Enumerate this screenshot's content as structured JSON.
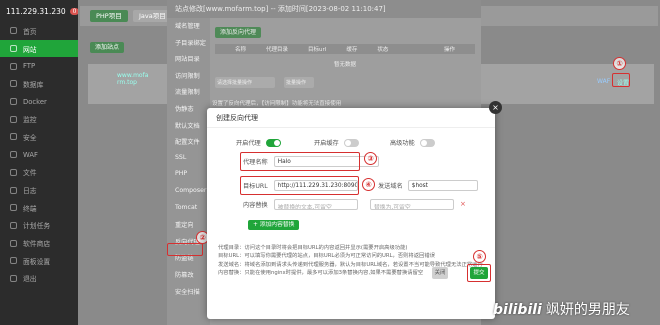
{
  "sidebar": {
    "server_ip": "111.229.31.230",
    "badge": "0",
    "items": [
      "首页",
      "网站",
      "FTP",
      "数据库",
      "Docker",
      "监控",
      "安全",
      "WAF",
      "文件",
      "日志",
      "终端",
      "计划任务",
      "软件商店",
      "面板设置",
      "退出"
    ],
    "active_index": 1
  },
  "background": {
    "tabs": [
      "PHP项目",
      "Java项目"
    ],
    "add_site": "添加站点",
    "site_name": "www.mofa\nrm.top",
    "setting_link": "设置",
    "waf_link": "WAF"
  },
  "site_dialog": {
    "title": "站点修改[www.mofarm.top] -- 添加时间[2023-08-02 11:10:47]",
    "nav": [
      "域名管理",
      "子目录绑定",
      "网站目录",
      "访问限制",
      "流量限制",
      "伪静态",
      "默认文档",
      "配置文件",
      "SSL",
      "PHP",
      "Composer",
      "Tomcat",
      "重定向",
      "反向代理",
      "防盗链",
      "防篡改",
      "安全扫描"
    ],
    "add_proxy_button": "添加反向代理",
    "columns": [
      "名称",
      "代理目录",
      "目标url",
      "缓存",
      "状态",
      "操作"
    ],
    "empty_text": "暂无数据",
    "bulk_select": "请选择批量操作",
    "bulk_exec": "批量操作",
    "tip": "设置了反向代理后，【访问限制】功能将无法直接使用"
  },
  "proxy_dialog": {
    "title": "创建反向代理",
    "enable_proxy_label": "开启代理",
    "enable_cache_label": "开启缓存",
    "advanced_label": "高级功能",
    "proxy_name_label": "代理名称",
    "proxy_name_value": "Halo",
    "target_url_label": "目标URL",
    "target_url_value": "http://111.229.31.230:8090",
    "send_domain_label": "发送域名",
    "send_domain_value": "$host",
    "content_replace_label": "内容替换",
    "replace_from_placeholder": "被替换的文本,可留空",
    "replace_to_placeholder": "替换为,可留空",
    "add_content_button": "+ 添加内容替换",
    "notes": [
      "代理目录：访问这个目录时将会把目标URL的内容返回并显示(需要开启高级功能)",
      "目标URL：可以填写你需要代理的站点，目标URL必须为可正常访问的URL，否则将返回错误",
      "发送域名：将域名添加到请求头传递到代理服务器，默认为目标URL域名，若设置不当可能导致代理无法正常运行",
      "内容替换：只能在使用nginx时提供，最多可以添加3条替换内容,如果不需要替换请留空"
    ],
    "close_button": "关闭",
    "submit_button": "提交"
  },
  "annotations": [
    "①",
    "②",
    "③",
    "④",
    "⑤"
  ],
  "watermark": {
    "logo": "bilibili",
    "text": "飒妍的男朋友"
  },
  "colors": {
    "green": "#20a53a",
    "annotation_red": "#d63030"
  }
}
